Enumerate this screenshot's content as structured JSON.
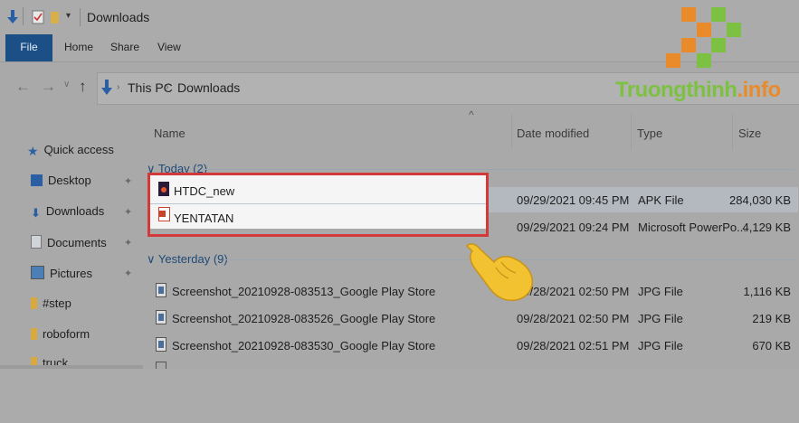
{
  "window": {
    "title": "Downloads"
  },
  "ribbon": {
    "tabs": [
      {
        "label": "File"
      },
      {
        "label": "Home"
      },
      {
        "label": "Share"
      },
      {
        "label": "View"
      }
    ]
  },
  "address": {
    "crumbs": [
      "This PC",
      "Downloads"
    ],
    "separator": "›"
  },
  "watermark": {
    "text": "Truongthinh",
    "suffix": ".info"
  },
  "nav": {
    "items": [
      {
        "label": "Quick access",
        "icon": "star-icon",
        "pinned": false
      },
      {
        "label": "Desktop",
        "icon": "desktop-icon",
        "pinned": true
      },
      {
        "label": "Downloads",
        "icon": "download-icon",
        "pinned": true
      },
      {
        "label": "Documents",
        "icon": "documents-icon",
        "pinned": true
      },
      {
        "label": "Pictures",
        "icon": "pictures-icon",
        "pinned": true
      },
      {
        "label": "#step",
        "icon": "folder-icon",
        "pinned": false
      },
      {
        "label": "roboform",
        "icon": "folder-icon",
        "pinned": false
      },
      {
        "label": "truck",
        "icon": "folder-icon",
        "pinned": false
      }
    ]
  },
  "columns": {
    "name": "Name",
    "date": "Date modified",
    "type": "Type",
    "size": "Size"
  },
  "groups": {
    "today": "Today (2)",
    "yesterday": "Yesterday (9)"
  },
  "files_today": [
    {
      "name": "HTDC_new",
      "date": "09/29/2021 09:45 PM",
      "type": "APK File",
      "size": "284,030 KB",
      "icon": "apk-file-icon"
    },
    {
      "name": "YENTATAN",
      "date": "09/29/2021 09:24 PM",
      "type": "Microsoft PowerPo...",
      "size": "4,129 KB",
      "icon": "pptx-file-icon"
    }
  ],
  "files_yesterday": [
    {
      "name": "Screenshot_20210928-083513_Google Play Store",
      "date": "09/28/2021 02:50 PM",
      "type": "JPG File",
      "size": "1,116 KB",
      "icon": "image-file-icon"
    },
    {
      "name": "Screenshot_20210928-083526_Google Play Store",
      "date": "09/28/2021 02:50 PM",
      "type": "JPG File",
      "size": "219 KB",
      "icon": "image-file-icon"
    },
    {
      "name": "Screenshot_20210928-083530_Google Play Store",
      "date": "09/28/2021 02:51 PM",
      "type": "JPG File",
      "size": "670 KB",
      "icon": "image-file-icon"
    }
  ],
  "colors": {
    "file_tab": "#1b4f86",
    "highlight": "#d23a3a",
    "watermark_green": "#7cc142",
    "watermark_orange": "#e98b2a",
    "hand": "#f2c230"
  }
}
